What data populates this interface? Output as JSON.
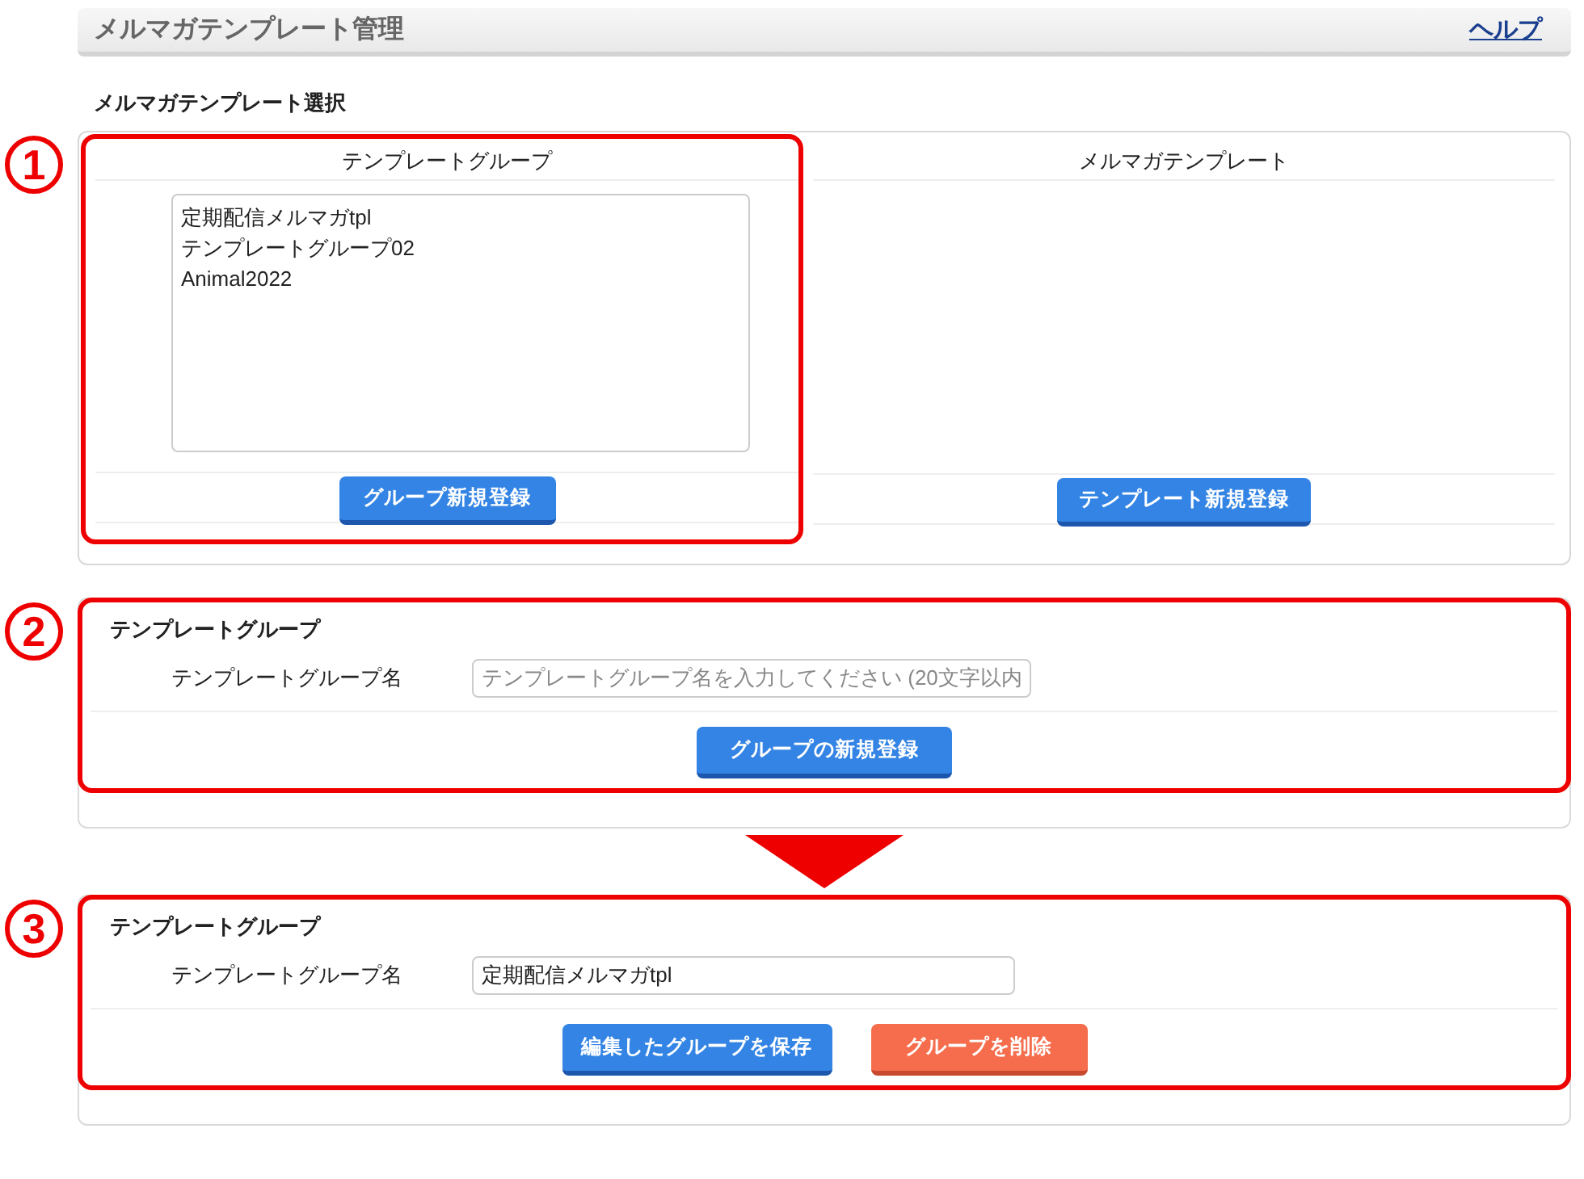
{
  "header": {
    "title": "メルマガテンプレート管理",
    "help_link": "ヘルプ"
  },
  "section_title": "メルマガテンプレート選択",
  "selection_panel": {
    "annotation": "1",
    "group_column": {
      "heading": "テンプレートグループ",
      "groups": [
        "定期配信メルマガtpl",
        "テンプレートグループ02",
        "Animal2022"
      ],
      "button": "グループ新規登録"
    },
    "template_column": {
      "heading": "メルマガテンプレート",
      "button": "テンプレート新規登録"
    }
  },
  "forms": [
    {
      "annotation": "2",
      "heading": "テンプレートグループ",
      "field_label": "テンプレートグループ名",
      "placeholder": "テンプレートグループ名を入力してください (20文字以内",
      "buttons": [
        {
          "label": "グループの新規登録",
          "kind": "primary"
        }
      ]
    },
    {
      "annotation": "3",
      "heading": "テンプレートグループ",
      "field_label": "テンプレートグループ名",
      "value": "定期配信メルマガtpl",
      "buttons": [
        {
          "label": "編集したグループを保存",
          "kind": "primary"
        },
        {
          "label": "グループを削除",
          "kind": "danger"
        }
      ]
    }
  ]
}
